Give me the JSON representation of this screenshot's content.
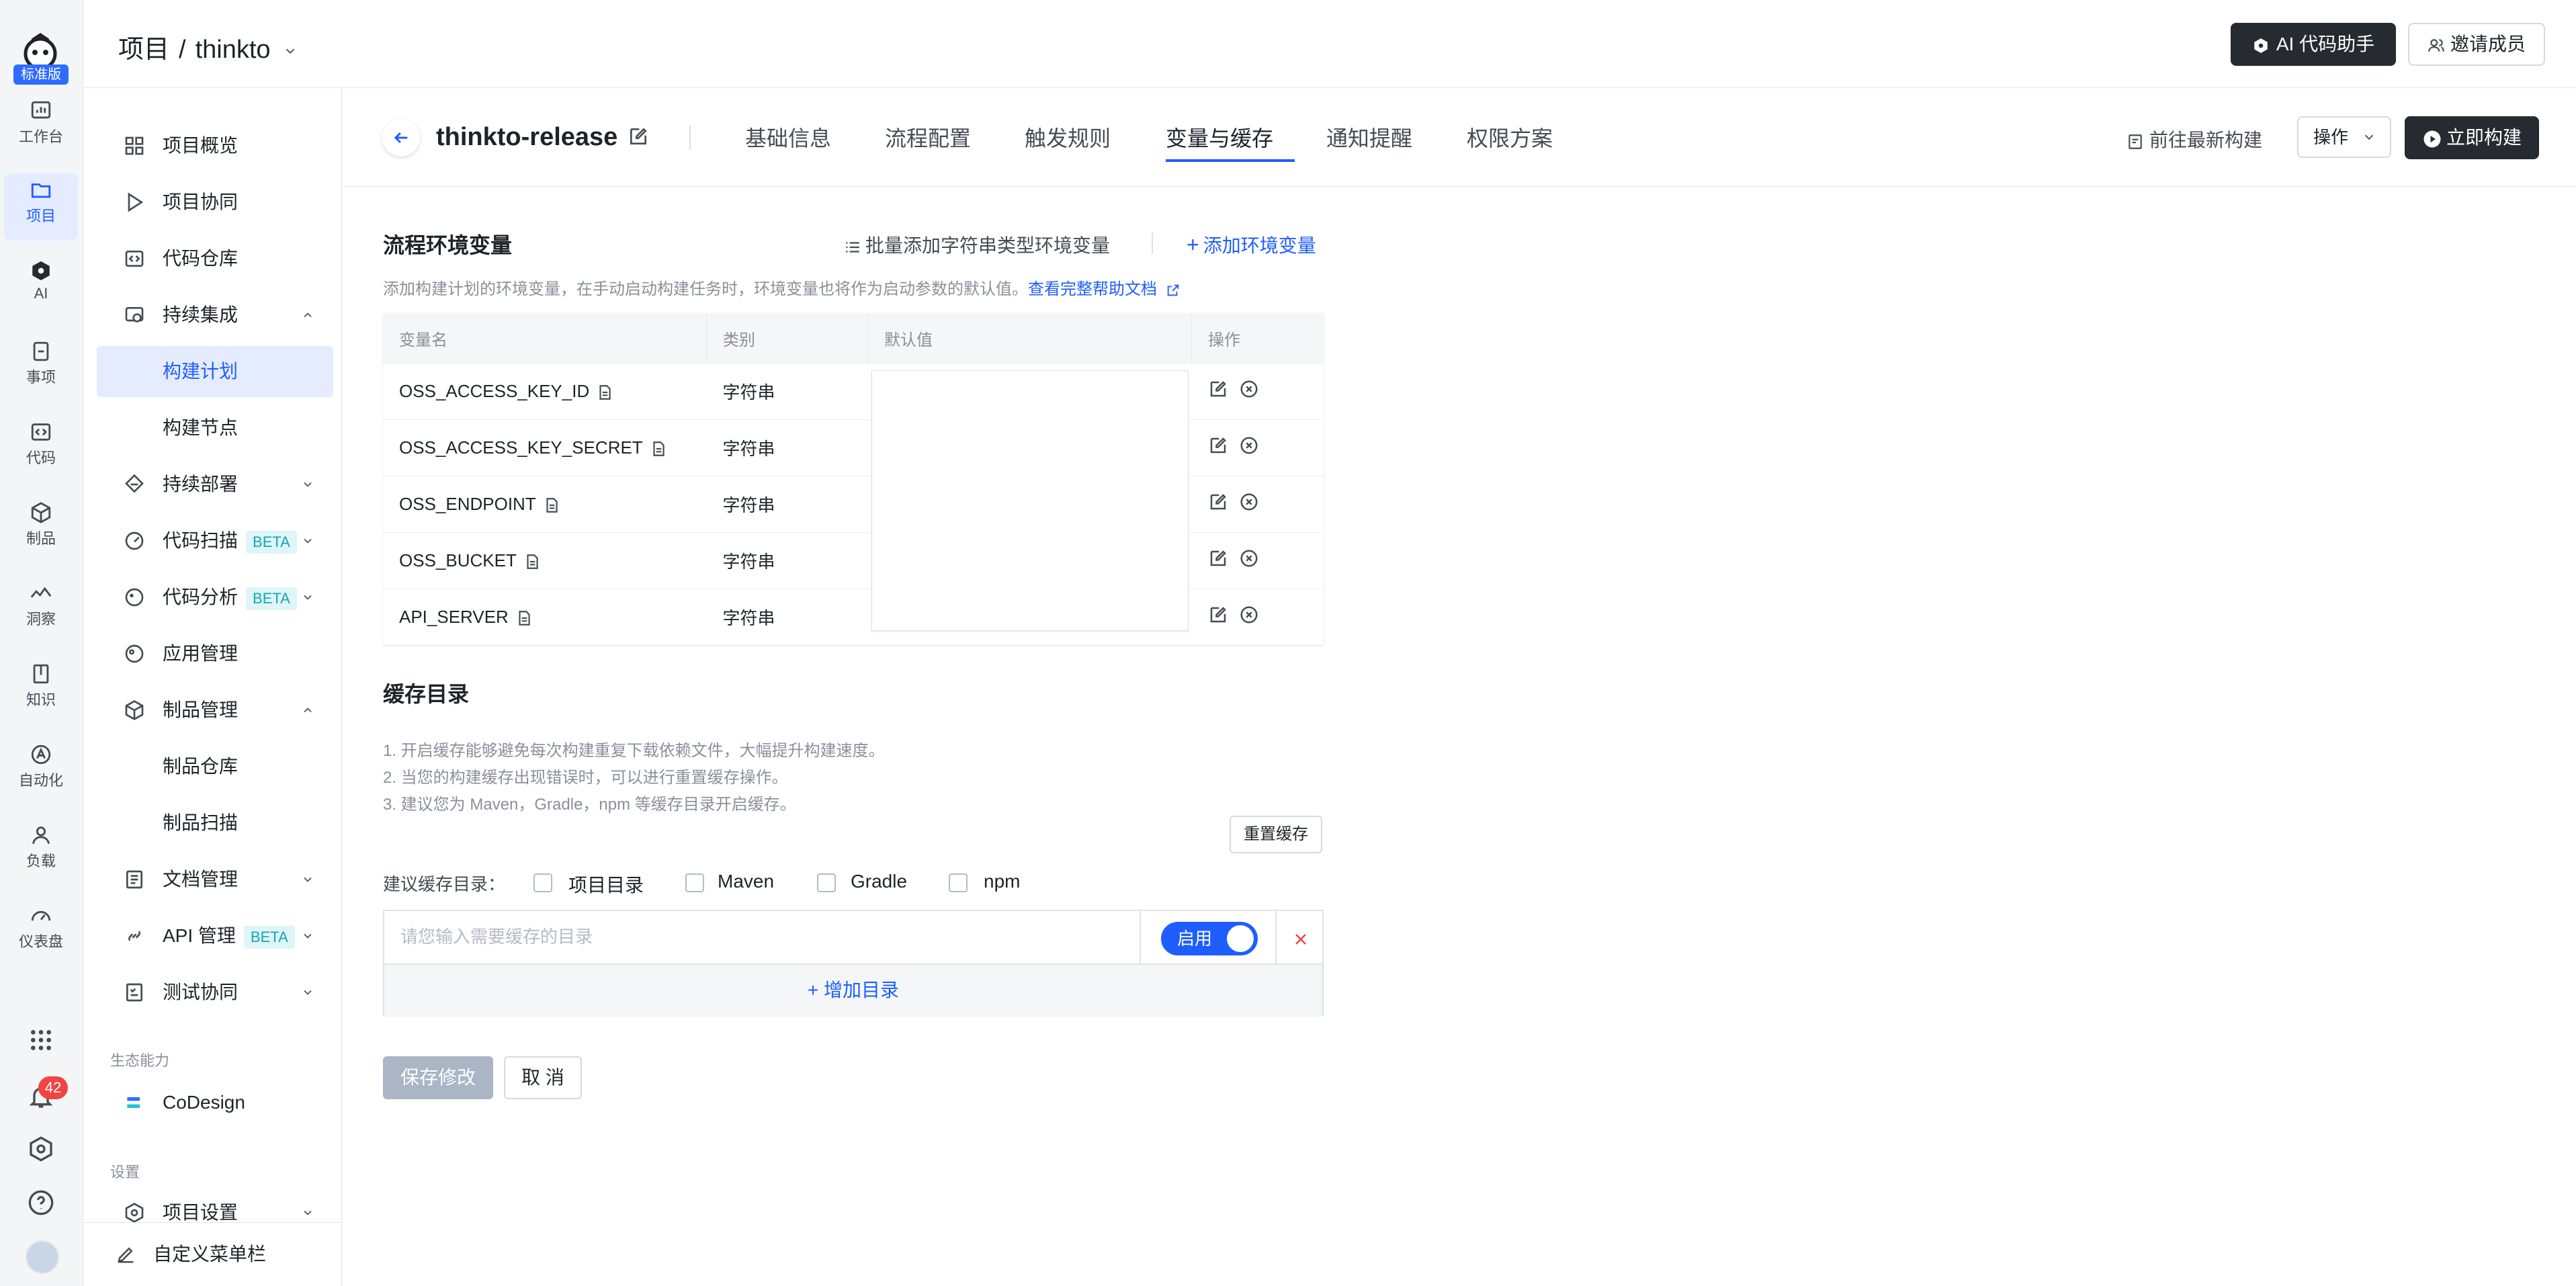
{
  "app": {
    "tier_badge": "标准版",
    "rail": [
      {
        "label": "工作台",
        "icon": "dashboard-icon"
      },
      {
        "label": "项目",
        "icon": "folder-icon",
        "active": true
      },
      {
        "label": "AI",
        "icon": "ai-icon"
      },
      {
        "label": "事项",
        "icon": "issue-icon"
      },
      {
        "label": "代码",
        "icon": "code-icon"
      },
      {
        "label": "制品",
        "icon": "package-icon"
      },
      {
        "label": "洞察",
        "icon": "insight-icon"
      },
      {
        "label": "知识",
        "icon": "book-icon"
      },
      {
        "label": "自动化",
        "icon": "automation-icon"
      },
      {
        "label": "负载",
        "icon": "user-load-icon"
      },
      {
        "label": "仪表盘",
        "icon": "gauge-icon"
      }
    ],
    "notification_count": "42"
  },
  "header": {
    "crumb_root": "项目",
    "crumb_sep": "/",
    "project_name": "thinkto",
    "ai_button": "AI 代码助手",
    "invite_button": "邀请成员"
  },
  "sidenav": {
    "items": [
      {
        "label": "项目概览"
      },
      {
        "label": "项目协同"
      },
      {
        "label": "代码仓库"
      },
      {
        "label": "持续集成"
      },
      {
        "label": "构建计划"
      },
      {
        "label": "构建节点"
      },
      {
        "label": "持续部署"
      },
      {
        "label": "代码扫描",
        "badge": "BETA"
      },
      {
        "label": "代码分析",
        "badge": "BETA"
      },
      {
        "label": "应用管理"
      },
      {
        "label": "制品管理"
      },
      {
        "label": "制品仓库"
      },
      {
        "label": "制品扫描"
      },
      {
        "label": "文档管理"
      },
      {
        "label": "API 管理",
        "badge": "BETA"
      },
      {
        "label": "测试协同"
      },
      {
        "label": "CoDesign"
      },
      {
        "label": "项目设置"
      }
    ],
    "group_ecosystem": "生态能力",
    "group_settings": "设置",
    "customize": "自定义菜单栏"
  },
  "plan": {
    "name": "thinkto-release",
    "tabs": [
      "基础信息",
      "流程配置",
      "触发规则",
      "变量与缓存",
      "通知提醒",
      "权限方案"
    ],
    "active_tab": "变量与缓存",
    "latest_build": "前往最新构建",
    "ops": "操作",
    "build_now": "立即构建"
  },
  "env": {
    "title": "流程环境变量",
    "batch_add": "批量添加字符串类型环境变量",
    "add_var": "添加环境变量",
    "desc": "添加构建计划的环境变量，在手动启动构建任务时，环境变量也将作为启动参数的默认值。",
    "help_link": "查看完整帮助文档",
    "columns": [
      "变量名",
      "类别",
      "默认值",
      "操作"
    ],
    "rows": [
      {
        "name": "OSS_ACCESS_KEY_ID",
        "type": "字符串"
      },
      {
        "name": "OSS_ACCESS_KEY_SECRET",
        "type": "字符串"
      },
      {
        "name": "OSS_ENDPOINT",
        "type": "字符串"
      },
      {
        "name": "OSS_BUCKET",
        "type": "字符串"
      },
      {
        "name": "API_SERVER",
        "type": "字符串"
      }
    ]
  },
  "cache": {
    "title": "缓存目录",
    "notes": [
      "1. 开启缓存能够避免每次构建重复下载依赖文件，大幅提升构建速度。",
      "2. 当您的构建缓存出现错误时，可以进行重置缓存操作。",
      "3. 建议您为 Maven，Gradle，npm 等缓存目录开启缓存。"
    ],
    "reset": "重置缓存",
    "suggest_label": "建议缓存目录：",
    "options": [
      "项目目录",
      "Maven",
      "Gradle",
      "npm"
    ],
    "input_placeholder": "请您输入需要缓存的目录",
    "toggle_label": "启用",
    "add_dir": "+ 增加目录"
  },
  "footer": {
    "save": "保存修改",
    "cancel": "取 消"
  }
}
